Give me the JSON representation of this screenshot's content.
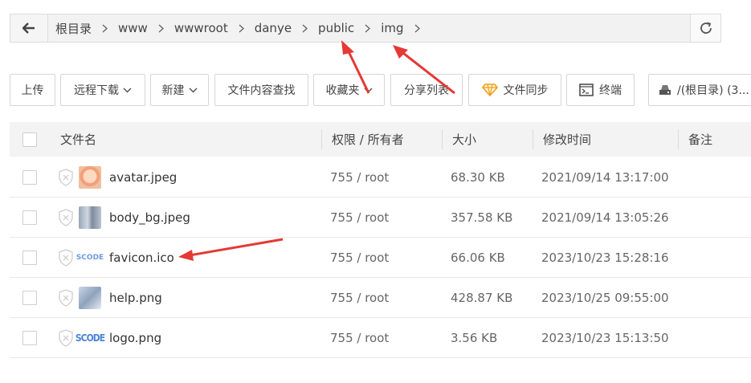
{
  "breadcrumb": {
    "items": [
      "根目录",
      "www",
      "wwwroot",
      "danye",
      "public",
      "img"
    ]
  },
  "toolbar": {
    "upload": "上传",
    "remote_download": "远程下载",
    "new": "新建",
    "content_search": "文件内容查找",
    "favorites": "收藏夹",
    "share_list": "分享列表",
    "file_sync": "文件同步",
    "terminal": "终端",
    "disk": "/(根目录) (3..."
  },
  "table": {
    "headers": {
      "name": "文件名",
      "perm": "权限 / 所有者",
      "size": "大小",
      "mtime": "修改时间",
      "note": "备注"
    },
    "rows": [
      {
        "name": "avatar.jpeg",
        "perm": "755 / root",
        "size": "68.30 KB",
        "mtime": "2021/09/14 13:17:00",
        "thumb": "avatar-image"
      },
      {
        "name": "body_bg.jpeg",
        "perm": "755 / root",
        "size": "357.58 KB",
        "mtime": "2021/09/14 13:05:26",
        "thumb": "bg-image"
      },
      {
        "name": "favicon.ico",
        "perm": "755 / root",
        "size": "66.06 KB",
        "mtime": "2023/10/23 15:28:16",
        "thumb": "scode-favicon",
        "thumb_text": "SCODE"
      },
      {
        "name": "help.png",
        "perm": "755 / root",
        "size": "428.87 KB",
        "mtime": "2023/10/25 09:55:00",
        "thumb": "help-image"
      },
      {
        "name": "logo.png",
        "perm": "755 / root",
        "size": "3.56 KB",
        "mtime": "2023/10/23 15:13:50",
        "thumb": "scode-logo",
        "thumb_text": "SCODE"
      }
    ]
  },
  "colors": {
    "annotation_arrow": "#e53935",
    "sync_icon": "#f0a020"
  }
}
